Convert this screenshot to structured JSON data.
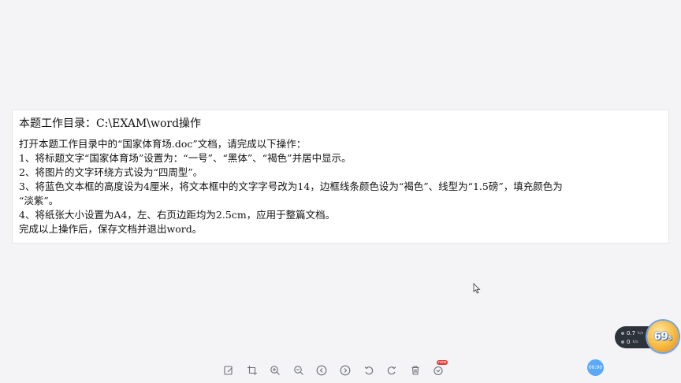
{
  "task": {
    "directory_line": "本题工作目录：C:\\EXAM\\word操作",
    "lines": [
      "打开本题工作目录中的“国家体育场.doc”文档，请完成以下操作：",
      "1、将标题文字“国家体育场”设置为：“一号”、“黑体”、“褐色”并居中显示。",
      "2、将图片的文字环绕方式设为“四周型”。",
      "3、将蓝色文本框的高度设为4厘米，将文本框中的文字字号改为14，边框线条颜色设为“褐色”、线型为“1.5磅”，填充颜色为",
      "“淡紫”。",
      "4、将纸张大小设置为A4，左、右页边距均为2.5cm，应用于整篇文档。",
      "完成以上操作后，保存文档并退出word。"
    ]
  },
  "toolbar": {
    "buttons": [
      {
        "name": "edit-icon"
      },
      {
        "name": "crop-icon"
      },
      {
        "name": "zoom-in-icon"
      },
      {
        "name": "zoom-out-icon"
      },
      {
        "name": "previous-icon"
      },
      {
        "name": "next-icon"
      },
      {
        "name": "undo-icon"
      },
      {
        "name": "redo-icon"
      },
      {
        "name": "delete-icon"
      },
      {
        "name": "more-icon",
        "badge": "new"
      }
    ]
  },
  "timer": {
    "label": "00:00"
  },
  "net_speed": {
    "upload_value": "0.7",
    "upload_unit": "k/s",
    "download_value": "0",
    "download_unit": "k/s"
  },
  "score_ball": {
    "value": "69",
    "suffix": "s"
  },
  "colors": {
    "background": "#f4f4f6",
    "card": "#ffffff",
    "icon": "#6b6f76",
    "timer": "#5aa9f5",
    "badge": "#e53935"
  }
}
